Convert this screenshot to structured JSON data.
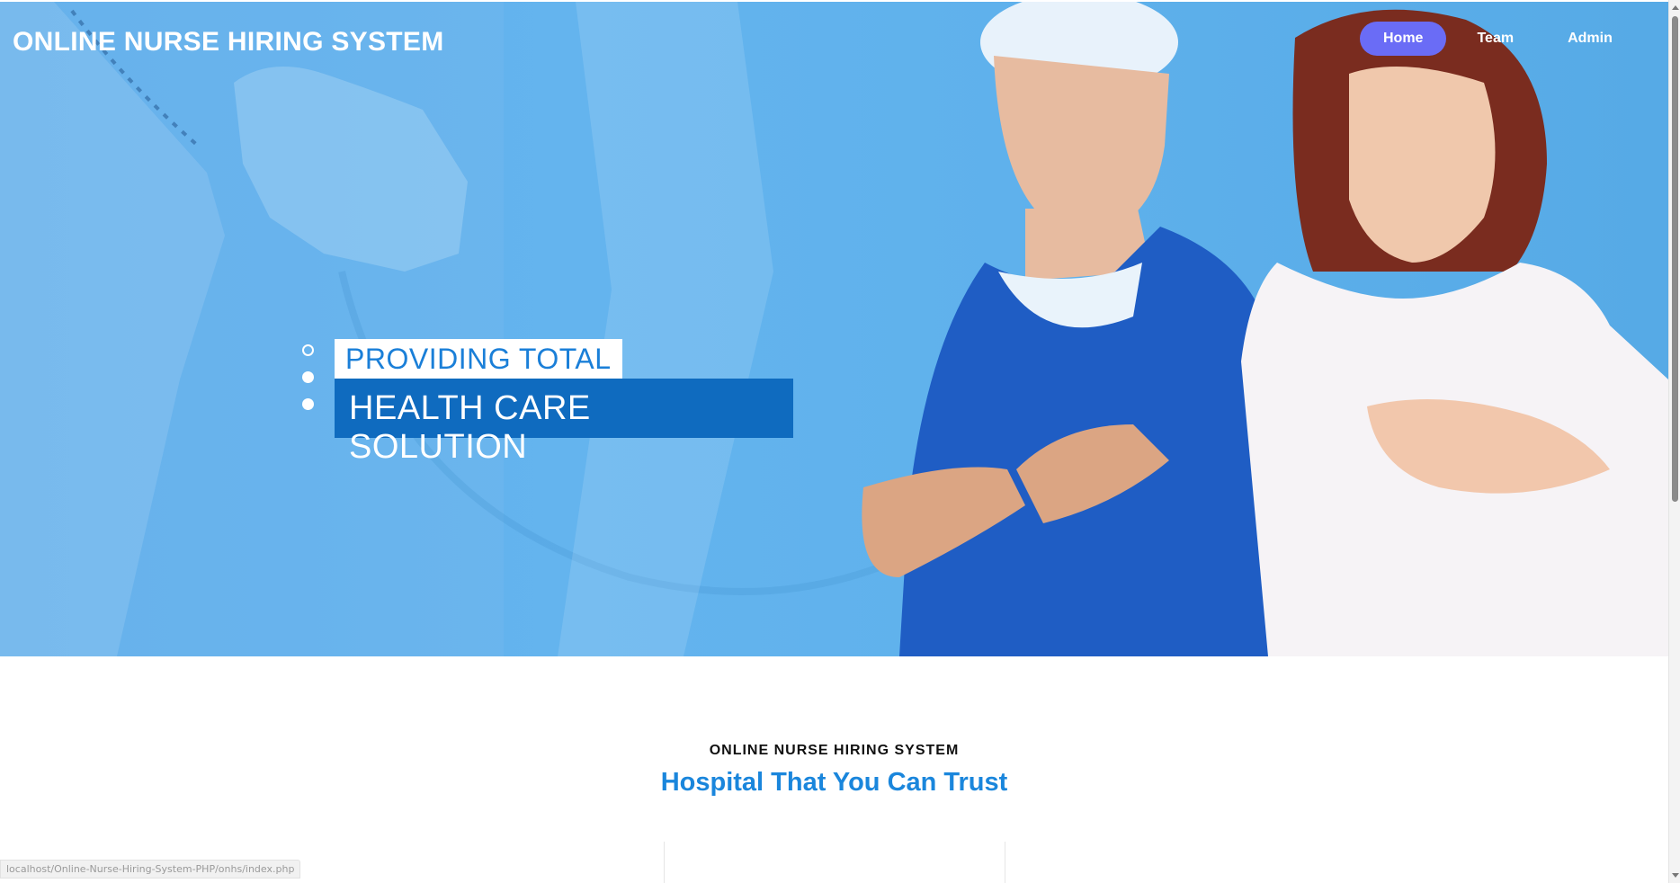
{
  "header": {
    "site_title": "ONLINE NURSE HIRING SYSTEM",
    "nav": [
      {
        "label": "Home",
        "active": true
      },
      {
        "label": "Team",
        "active": false
      },
      {
        "label": "Admin",
        "active": false
      }
    ]
  },
  "hero": {
    "tagline_line1": "PROVIDING TOTAL",
    "tagline_line2": "HEALTH CARE SOLUTION",
    "slide_count": 3,
    "active_slide": 1
  },
  "section": {
    "kicker": "ONLINE NURSE HIRING SYSTEM",
    "heading": "Hospital That You Can Trust"
  },
  "status_bar": {
    "url": "localhost/Online-Nurse-Hiring-System-PHP/onhs/index.php"
  },
  "colors": {
    "hero_blue": "#5eaeea",
    "nav_active": "#6a6cf6",
    "tagline_dark": "#0f6bbf",
    "heading_blue": "#1a86dc"
  }
}
